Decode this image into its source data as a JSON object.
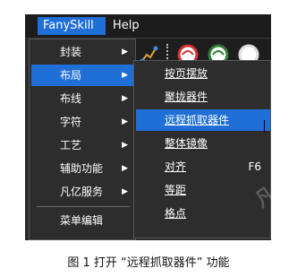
{
  "menubar": {
    "items": [
      {
        "label": "FanySkill",
        "active": true
      },
      {
        "label": "Help",
        "active": false
      }
    ]
  },
  "menu1": {
    "items": [
      {
        "label": "封装",
        "has_submenu": true,
        "active": false
      },
      {
        "label": "布局",
        "has_submenu": true,
        "active": true
      },
      {
        "label": "布线",
        "has_submenu": true,
        "active": false
      },
      {
        "label": "字符",
        "has_submenu": true,
        "active": false
      },
      {
        "label": "工艺",
        "has_submenu": true,
        "active": false
      },
      {
        "label": "辅助功能",
        "has_submenu": true,
        "active": false
      },
      {
        "label": "凡亿服务",
        "has_submenu": true,
        "active": false
      },
      {
        "label": "菜单编辑",
        "has_submenu": false,
        "active": false
      }
    ],
    "arrow_glyph": "▶"
  },
  "menu2": {
    "items": [
      {
        "label": "按页摆放",
        "shortcut": "",
        "active": false
      },
      {
        "label": "聚拢器件",
        "shortcut": "",
        "active": false
      },
      {
        "label": "远程抓取器件",
        "shortcut": "",
        "active": true
      },
      {
        "label": "整体镜像",
        "shortcut": "",
        "active": false
      },
      {
        "label": "对齐",
        "shortcut": "F6",
        "active": false
      },
      {
        "label": "等距",
        "shortcut": "",
        "active": false
      },
      {
        "label": "格点",
        "shortcut": "",
        "active": false
      }
    ]
  },
  "toolbar": {
    "icons": [
      "route-icon",
      "red-circle-icon",
      "green-circle-icon"
    ]
  },
  "colors": {
    "highlight": "#1f6fd6",
    "menu_bg": "#2d2d2d",
    "text": "#ffffff"
  },
  "watermark": "凡亿电",
  "caption": "图 1  打开 “远程抓取器件” 功能"
}
